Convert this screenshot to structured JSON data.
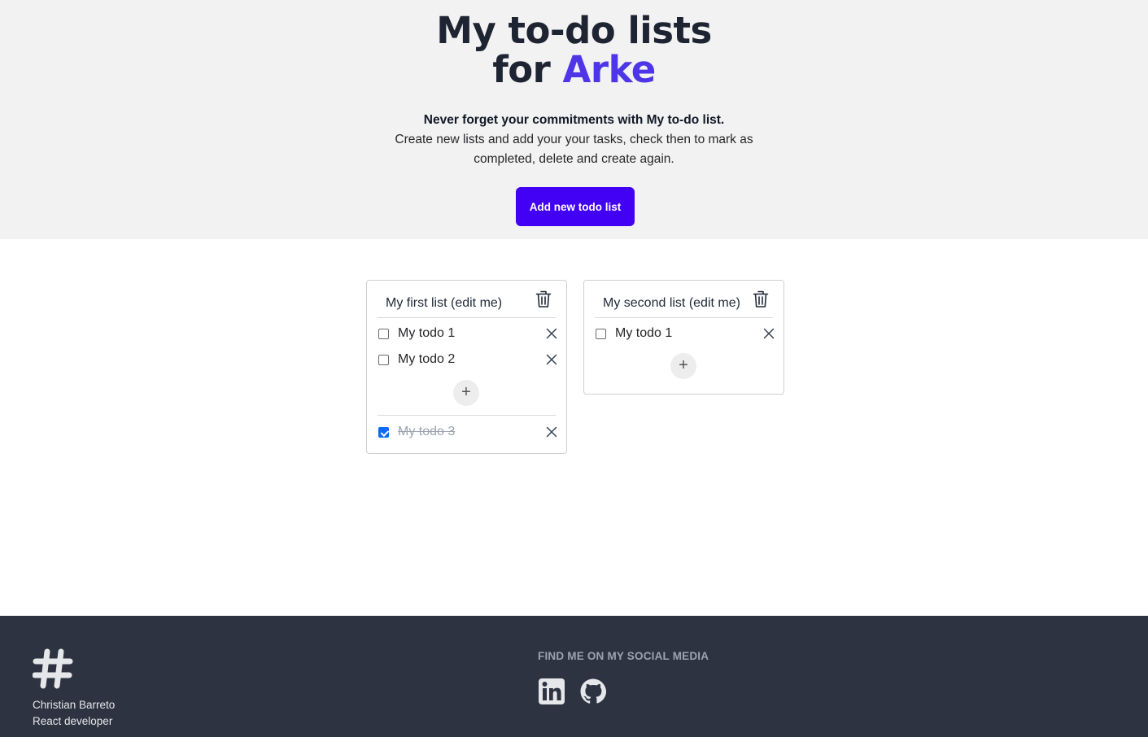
{
  "hero": {
    "title_line1": "My to-do lists",
    "title_for": "for",
    "title_name": "Arke",
    "tagline": "Never forget your commitments with My to-do list.",
    "description": "Create new lists and add your your tasks, check then to mark as completed, delete and create again.",
    "add_button": "Add new todo list"
  },
  "lists": [
    {
      "title": "My first list (edit me)",
      "pending": [
        {
          "label": "My todo 1",
          "checked": false
        },
        {
          "label": "My todo 2",
          "checked": false
        }
      ],
      "completed": [
        {
          "label": "My todo 3",
          "checked": true
        }
      ],
      "add_symbol": "+"
    },
    {
      "title": "My second list (edit me)",
      "pending": [
        {
          "label": "My todo 1",
          "checked": false
        }
      ],
      "completed": [],
      "add_symbol": "+"
    }
  ],
  "footer": {
    "logo_icon": "hashtag-icon",
    "author_name": "Christian Barreto",
    "author_role": "React developer",
    "social_title": "FIND ME ON MY SOCIAL MEDIA",
    "social_icons": [
      "linkedin-icon",
      "github-icon"
    ]
  },
  "colors": {
    "accent": "#4f35e8",
    "button": "#4200f5",
    "hero_bg": "#f2f2f2",
    "footer_bg": "#2d3340",
    "checkbox_checked": "#0b6cf0"
  }
}
